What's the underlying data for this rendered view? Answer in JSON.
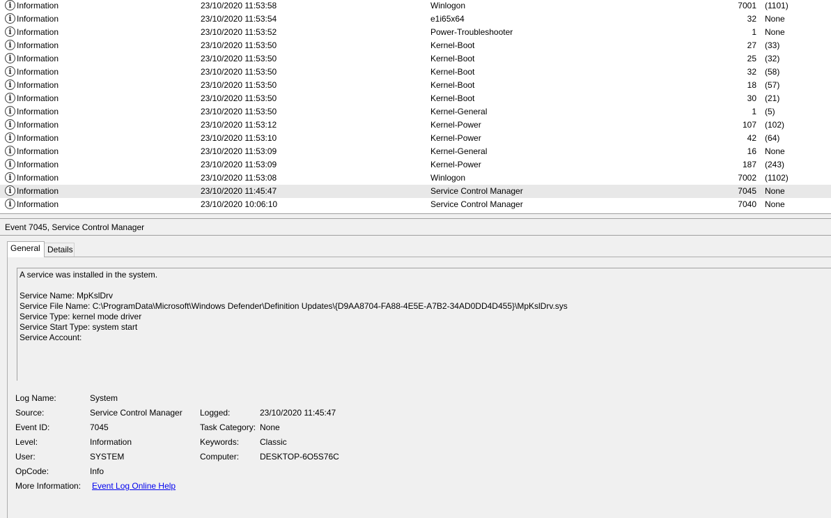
{
  "events": [
    {
      "level": "Information",
      "date": "23/10/2020 11:53:58",
      "source": "Winlogon",
      "event_id": "7001",
      "category": "(1101)"
    },
    {
      "level": "Information",
      "date": "23/10/2020 11:53:54",
      "source": "e1i65x64",
      "event_id": "32",
      "category": "None"
    },
    {
      "level": "Information",
      "date": "23/10/2020 11:53:52",
      "source": "Power-Troubleshooter",
      "event_id": "1",
      "category": "None"
    },
    {
      "level": "Information",
      "date": "23/10/2020 11:53:50",
      "source": "Kernel-Boot",
      "event_id": "27",
      "category": "(33)"
    },
    {
      "level": "Information",
      "date": "23/10/2020 11:53:50",
      "source": "Kernel-Boot",
      "event_id": "25",
      "category": "(32)"
    },
    {
      "level": "Information",
      "date": "23/10/2020 11:53:50",
      "source": "Kernel-Boot",
      "event_id": "32",
      "category": "(58)"
    },
    {
      "level": "Information",
      "date": "23/10/2020 11:53:50",
      "source": "Kernel-Boot",
      "event_id": "18",
      "category": "(57)"
    },
    {
      "level": "Information",
      "date": "23/10/2020 11:53:50",
      "source": "Kernel-Boot",
      "event_id": "30",
      "category": "(21)"
    },
    {
      "level": "Information",
      "date": "23/10/2020 11:53:50",
      "source": "Kernel-General",
      "event_id": "1",
      "category": "(5)"
    },
    {
      "level": "Information",
      "date": "23/10/2020 11:53:12",
      "source": "Kernel-Power",
      "event_id": "107",
      "category": "(102)"
    },
    {
      "level": "Information",
      "date": "23/10/2020 11:53:10",
      "source": "Kernel-Power",
      "event_id": "42",
      "category": "(64)"
    },
    {
      "level": "Information",
      "date": "23/10/2020 11:53:09",
      "source": "Kernel-General",
      "event_id": "16",
      "category": "None"
    },
    {
      "level": "Information",
      "date": "23/10/2020 11:53:09",
      "source": "Kernel-Power",
      "event_id": "187",
      "category": "(243)"
    },
    {
      "level": "Information",
      "date": "23/10/2020 11:53:08",
      "source": "Winlogon",
      "event_id": "7002",
      "category": "(1102)"
    },
    {
      "level": "Information",
      "date": "23/10/2020 11:45:47",
      "source": "Service Control Manager",
      "event_id": "7045",
      "category": "None"
    },
    {
      "level": "Information",
      "date": "23/10/2020 10:06:10",
      "source": "Service Control Manager",
      "event_id": "7040",
      "category": "None"
    }
  ],
  "info_icon_glyph": "i",
  "selected_row_color": "#e8e8e8",
  "detail": {
    "title": "Event 7045, Service Control Manager",
    "tabs": {
      "general": "General",
      "details": "Details"
    },
    "message": {
      "line1": "A service was installed in the system.",
      "service_name": "Service Name:  MpKslDrv",
      "service_file": "Service File Name:  C:\\ProgramData\\Microsoft\\Windows Defender\\Definition Updates\\{D9AA8704-FA88-4E5E-A7B2-34AD0DD4D455}\\MpKslDrv.sys",
      "service_type": "Service Type:  kernel mode driver",
      "start_type": "Service Start Type:  system start",
      "account": "Service Account:"
    },
    "props": {
      "log_name_label": "Log Name:",
      "log_name_value": "System",
      "source_label": "Source:",
      "source_value": "Service Control Manager",
      "logged_label": "Logged:",
      "logged_value": "23/10/2020 11:45:47",
      "event_id_label": "Event ID:",
      "event_id_value": "7045",
      "task_category_label": "Task Category:",
      "task_category_value": "None",
      "level_label": "Level:",
      "level_value": "Information",
      "keywords_label": "Keywords:",
      "keywords_value": "Classic",
      "user_label": "User:",
      "user_value": "SYSTEM",
      "computer_label": "Computer:",
      "computer_value": "DESKTOP-6O5S76C",
      "opcode_label": "OpCode:",
      "opcode_value": "Info",
      "more_info_label": "More Information:",
      "more_info_link": "Event Log Online Help"
    }
  }
}
